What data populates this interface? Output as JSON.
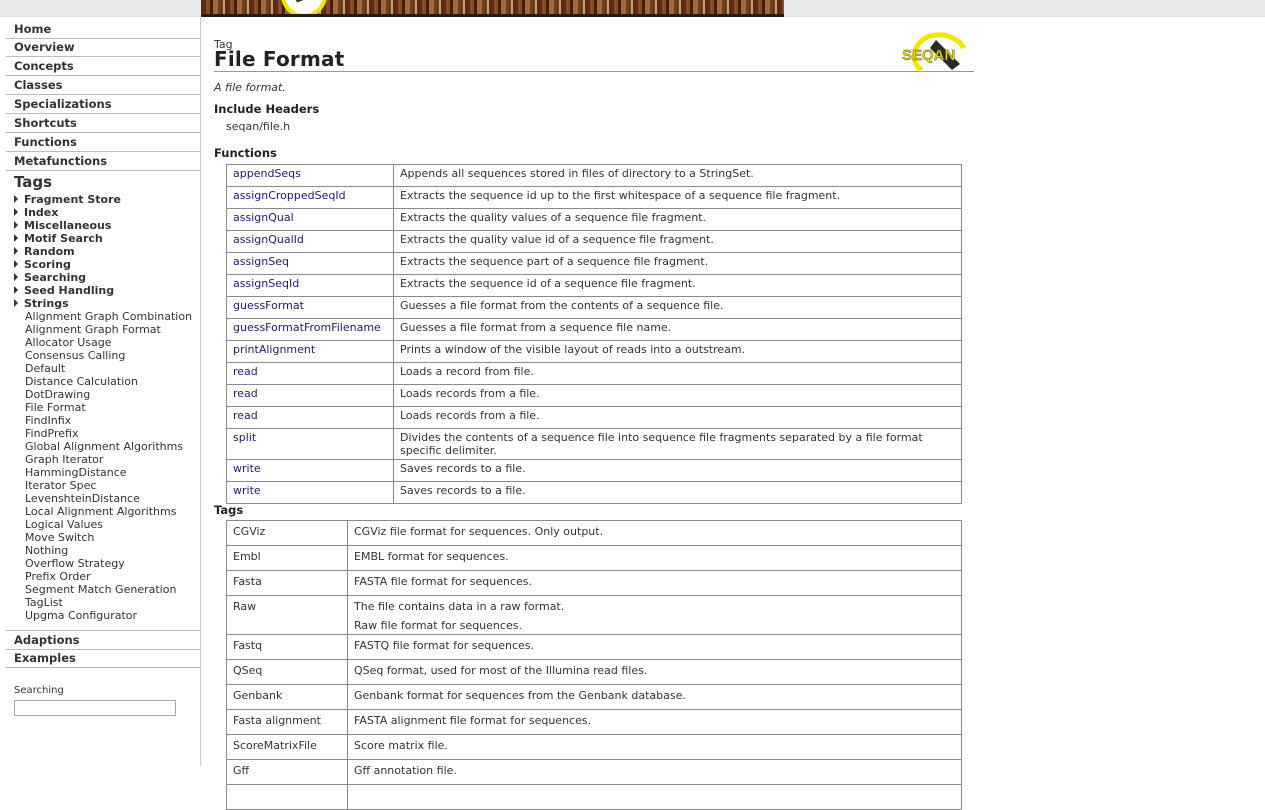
{
  "sidebar": {
    "main_nav": [
      "Home",
      "Overview",
      "Concepts",
      "Classes",
      "Specializations",
      "Shortcuts",
      "Functions",
      "Metafunctions"
    ],
    "tags_heading": "Tags",
    "tag_categories": [
      "Fragment Store",
      "Index",
      "Miscellaneous",
      "Motif Search",
      "Random",
      "Scoring",
      "Searching",
      "Seed Handling",
      "Strings"
    ],
    "tag_items": [
      "Alignment Graph Combination",
      "Alignment Graph Format",
      "Allocator Usage",
      "Consensus Calling",
      "Default",
      "Distance Calculation",
      "DotDrawing",
      "File Format",
      "FindInfix",
      "FindPrefix",
      "Global Alignment Algorithms",
      "Graph Iterator",
      "HammingDistance",
      "Iterator Spec",
      "LevenshteinDistance",
      "Local Alignment Algorithms",
      "Logical Values",
      "Move Switch",
      "Nothing",
      "Overflow Strategy",
      "Prefix Order",
      "Segment Match Generation",
      "TagList",
      "Upgma Configurator"
    ],
    "bottom_nav": [
      "Adaptions",
      "Examples"
    ],
    "search_label": "Searching",
    "search_value": ""
  },
  "main": {
    "kind": "Tag",
    "title": "File Format",
    "summary": "A file format.",
    "include_heading": "Include Headers",
    "include_value": "seqan/file.h",
    "functions_heading": "Functions",
    "functions": [
      {
        "name": "appendSeqs",
        "desc": "Appends all sequences stored in files of directory to a StringSet."
      },
      {
        "name": "assignCroppedSeqId",
        "desc": "Extracts the sequence id up to the first whitespace of a sequence file fragment."
      },
      {
        "name": "assignQual",
        "desc": "Extracts the quality values of a sequence file fragment."
      },
      {
        "name": "assignQualId",
        "desc": "Extracts the quality value id of a sequence file fragment."
      },
      {
        "name": "assignSeq",
        "desc": "Extracts the sequence part of a sequence file fragment."
      },
      {
        "name": "assignSeqId",
        "desc": "Extracts the sequence id of a sequence file fragment."
      },
      {
        "name": "guessFormat",
        "desc": "Guesses a file format from the contents of a sequence file."
      },
      {
        "name": "guessFormatFromFilename",
        "desc": "Guesses a file format from a sequence file name."
      },
      {
        "name": "printAlignment",
        "desc": "Prints a window of the visible layout of reads into a outstream."
      },
      {
        "name": "read",
        "desc": "Loads a record from file."
      },
      {
        "name": "read",
        "desc": "Loads records from a file."
      },
      {
        "name": "read",
        "desc": "Loads records from a file."
      },
      {
        "name": "split",
        "desc": "Divides the contents of a sequence file into sequence file fragments separated by a file format specific delimiter."
      },
      {
        "name": "write",
        "desc": "Saves records to a file."
      },
      {
        "name": "write",
        "desc": "Saves records to a file."
      }
    ],
    "tags_heading": "Tags",
    "tags": [
      {
        "name": "CGViz",
        "desc": "CGViz file format for sequences. Only output."
      },
      {
        "name": "Embl",
        "desc": "EMBL format for sequences."
      },
      {
        "name": "Fasta",
        "desc": "FASTA file format for sequences."
      },
      {
        "name": "Raw",
        "desc": "The file contains data in a raw format.",
        "desc2": "Raw file format for sequences."
      },
      {
        "name": "Fastq",
        "desc": "FASTQ file format for sequences."
      },
      {
        "name": "QSeq",
        "desc": "QSeq format, used for most of the Illumina read files."
      },
      {
        "name": "Genbank",
        "desc": "Genbank format for sequences from the Genbank database."
      },
      {
        "name": "Fasta alignment",
        "desc": "FASTA alignment file format for sequences."
      },
      {
        "name": "ScoreMatrixFile",
        "desc": "Score matrix file."
      },
      {
        "name": "Gff",
        "desc": "Gff annotation file."
      },
      {
        "name": "",
        "desc": ""
      }
    ]
  },
  "logo": {
    "text": "SEQAN",
    "accent": "#f2e600"
  },
  "colors": {
    "link": "#1a1a80",
    "border": "#8a8a8a"
  }
}
